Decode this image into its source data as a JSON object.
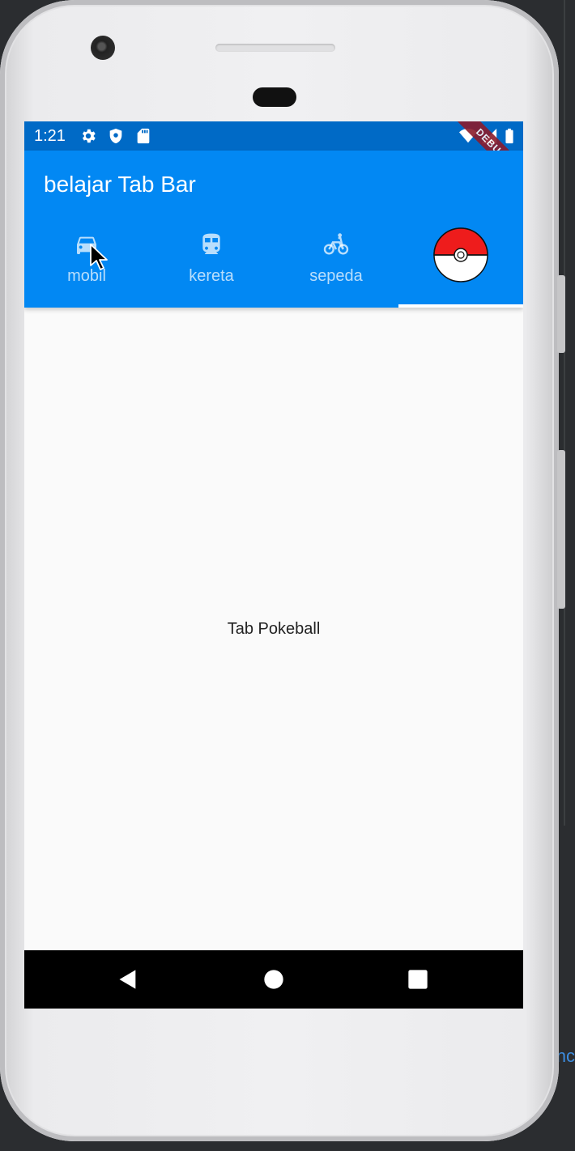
{
  "status_bar": {
    "time": "1:21",
    "left_icons": [
      "settings-icon",
      "shield-icon",
      "sd-card-icon"
    ],
    "right_icons": [
      "wifi-icon",
      "signal-icon",
      "battery-icon"
    ],
    "debug_label": "DEBUG",
    "color": "#006ac6"
  },
  "app_bar": {
    "title": "belajar Tab Bar",
    "color": "#0288f3"
  },
  "tabs": [
    {
      "label": "mobil",
      "icon": "car-icon",
      "selected": false
    },
    {
      "label": "kereta",
      "icon": "train-icon",
      "selected": false
    },
    {
      "label": "sepeda",
      "icon": "bicycle-icon",
      "selected": false
    },
    {
      "label": "",
      "icon": "pokeball-icon",
      "selected": true
    }
  ],
  "content": {
    "text": "Tab Pokeball"
  },
  "nav_bar": {
    "buttons": [
      "back-icon",
      "home-icon",
      "recents-icon"
    ]
  },
  "ide_fragment": "nc"
}
